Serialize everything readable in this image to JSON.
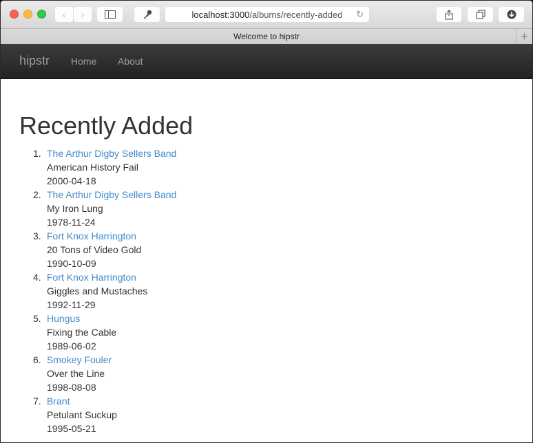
{
  "browser": {
    "url_host": "localhost:3000",
    "url_path": "/albums/recently-added",
    "tab_title": "Welcome to hipstr",
    "icons": {
      "back": "‹",
      "forward": "›",
      "sidebar": "▯",
      "key": "🔑",
      "reload": "↻",
      "share": "⇪",
      "tabs": "❐",
      "download": "⬇",
      "new_tab": "+"
    }
  },
  "navbar": {
    "brand": "hipstr",
    "links": [
      "Home",
      "About"
    ]
  },
  "page": {
    "title": "Recently Added",
    "albums": [
      {
        "num": "1.",
        "artist": "The Arthur Digby Sellers Band",
        "album": "American History Fail",
        "date": "2000-04-18"
      },
      {
        "num": "2.",
        "artist": "The Arthur Digby Sellers Band",
        "album": "My Iron Lung",
        "date": "1978-11-24"
      },
      {
        "num": "3.",
        "artist": "Fort Knox Harrington",
        "album": "20 Tons of Video Gold",
        "date": "1990-10-09"
      },
      {
        "num": "4.",
        "artist": "Fort Knox Harrington",
        "album": "Giggles and Mustaches",
        "date": "1992-11-29"
      },
      {
        "num": "5.",
        "artist": "Hungus",
        "album": "Fixing the Cable",
        "date": "1989-06-02"
      },
      {
        "num": "6.",
        "artist": "Smokey Fouler",
        "album": "Over the Line",
        "date": "1998-08-08"
      },
      {
        "num": "7.",
        "artist": "Brant",
        "album": "Petulant Suckup",
        "date": "1995-05-21"
      }
    ]
  },
  "colors": {
    "link": "#428bca",
    "navbar": "#222222"
  }
}
